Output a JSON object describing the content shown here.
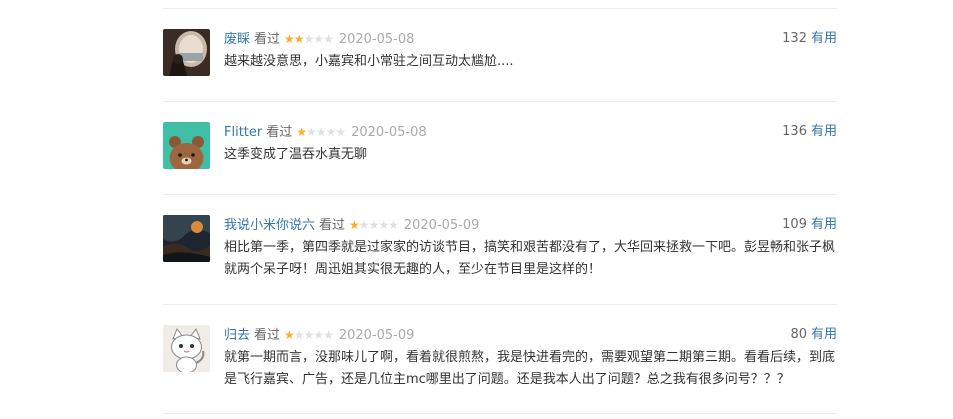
{
  "comments": [
    {
      "user": "废睬",
      "action": "看过",
      "rating": 2,
      "date": "2020-05-08",
      "votes": "132",
      "vote_label": "有用",
      "text": "越来越没意思，小嘉宾和小常驻之间互动太尴尬....",
      "avatar": "porthole-photo-avatar"
    },
    {
      "user": "Flitter",
      "action": "看过",
      "rating": 1,
      "date": "2020-05-08",
      "votes": "136",
      "vote_label": "有用",
      "text": "这季变成了温吞水真无聊",
      "avatar": "brown-bear-avatar"
    },
    {
      "user": "我说小米你说六",
      "action": "看过",
      "rating": 1,
      "date": "2020-05-09",
      "votes": "109",
      "vote_label": "有用",
      "text": "相比第一季，第四季就是过家家的访谈节目，搞笑和艰苦都没有了，大华回来拯救一下吧。彭昱畅和张子枫就两个呆子呀！周迅姐其实很无趣的人，至少在节目里是这样的！",
      "avatar": "dark-landscape-avatar"
    },
    {
      "user": "归去",
      "action": "看过",
      "rating": 1,
      "date": "2020-05-09",
      "votes": "80",
      "vote_label": "有用",
      "text": "就第一期而言，没那味儿了啊，看着就很煎熬，我是快进看完的，需要观望第二期第三期。看看后续，到底是飞行嘉宾、广告，还是几位主mc哪里出了问题。还是我本人出了问题？总之我有很多问号？？？",
      "avatar": "cartoon-cat-avatar"
    }
  ],
  "colors": {
    "link": "#3377aa",
    "star_on": "#ffac2d",
    "star_off": "#e0e0e0",
    "date": "#aaaaaa"
  }
}
